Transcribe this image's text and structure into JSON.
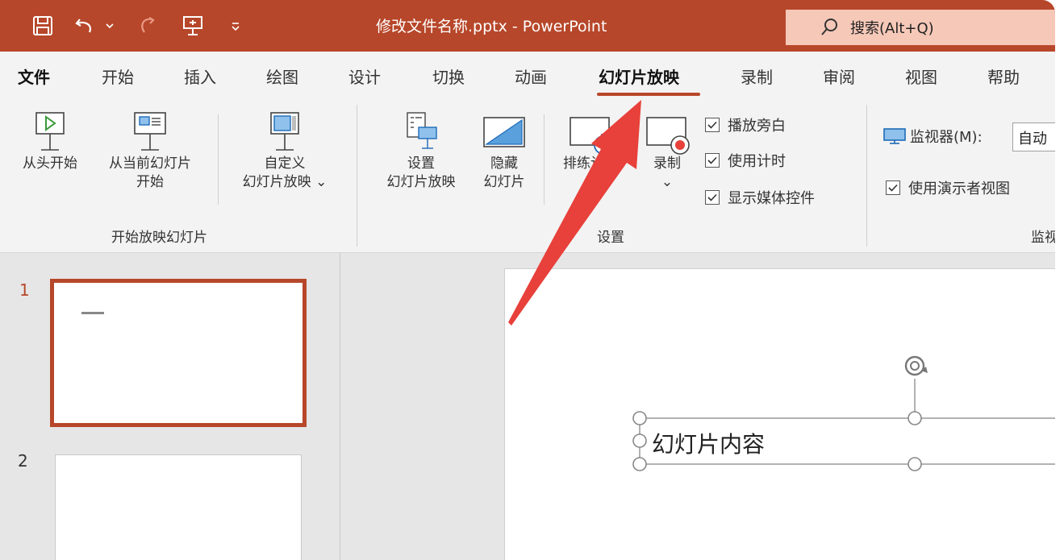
{
  "titlebar": {
    "doc_title": "修改文件名称.pptx  -  PowerPoint",
    "search_label": "搜索(Alt+Q)"
  },
  "tabs": [
    {
      "label": "文件"
    },
    {
      "label": "开始"
    },
    {
      "label": "插入"
    },
    {
      "label": "绘图"
    },
    {
      "label": "设计"
    },
    {
      "label": "切换"
    },
    {
      "label": "动画"
    },
    {
      "label": "幻灯片放映"
    },
    {
      "label": "录制"
    },
    {
      "label": "审阅"
    },
    {
      "label": "视图"
    },
    {
      "label": "帮助"
    }
  ],
  "active_tab": "幻灯片放映",
  "ribbon": {
    "start_group": {
      "from_beginning": "从头开始",
      "from_current_1": "从当前幻灯片",
      "from_current_2": "开始",
      "custom_1": "自定义",
      "custom_2": "幻灯片放映",
      "label": "开始放映幻灯片"
    },
    "setup_group": {
      "setup_1": "设置",
      "setup_2": "幻灯片放映",
      "hide_1": "隐藏",
      "hide_2": "幻灯片",
      "rehearse": "排练计时",
      "record": "录制",
      "play_narration": "播放旁白",
      "use_timings": "使用计时",
      "show_media_controls": "显示媒体控件",
      "label": "设置"
    },
    "monitor_group": {
      "monitor_label": "监视器(M):",
      "monitor_value": "自动",
      "presenter_view": "使用演示者视图",
      "label": "监视器"
    }
  },
  "slides": [
    {
      "number": "1",
      "selected": true
    },
    {
      "number": "2",
      "selected": false
    }
  ],
  "slide_content": {
    "text": "幻灯片内容"
  },
  "colors": {
    "accent": "#b7472a",
    "annotation_arrow": "#e8403a"
  }
}
